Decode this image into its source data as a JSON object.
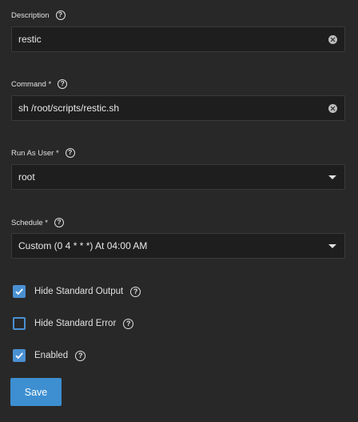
{
  "description": {
    "label": "Description",
    "help_glyph": "?",
    "value": "restic"
  },
  "command": {
    "label": "Command *",
    "help_glyph": "?",
    "value": "sh /root/scripts/restic.sh"
  },
  "run_as_user": {
    "label": "Run As User *",
    "help_glyph": "?",
    "value": "root"
  },
  "schedule": {
    "label": "Schedule *",
    "help_glyph": "?",
    "value": "Custom (0 4 * * *) At 04:00 AM"
  },
  "checkboxes": [
    {
      "label": "Hide Standard Output",
      "checked": true,
      "help_glyph": "?"
    },
    {
      "label": "Hide Standard Error",
      "checked": false,
      "help_glyph": "?"
    },
    {
      "label": "Enabled",
      "checked": true,
      "help_glyph": "?"
    }
  ],
  "save_label": "Save",
  "colors": {
    "background": "#282828",
    "input_background": "#1e1e1e",
    "accent": "#4a90d2",
    "button": "#3d8fd1"
  },
  "icons": {
    "help": "help-circle-icon",
    "clear": "clear-circle-icon",
    "dropdown": "caret-down-icon",
    "check": "checkmark-icon"
  }
}
